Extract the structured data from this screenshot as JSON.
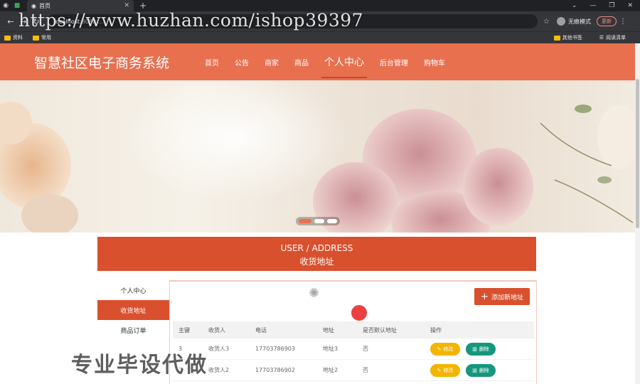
{
  "browser": {
    "tab_title": "首页",
    "url_host": "localhost",
    "url_rest": ":8080/...",
    "profile_label": "无痕模式",
    "update_label": "更新",
    "bookmarks": [
      "资料",
      "常用"
    ],
    "bookmarks_right": [
      "其他书签",
      "阅读清单"
    ]
  },
  "watermark_url": "https://www.huzhan.com/ishop39397",
  "header": {
    "logo": "智慧社区电子商务系统",
    "nav": [
      "首页",
      "公告",
      "商家",
      "商品",
      "个人中心",
      "后台管理",
      "购物车"
    ],
    "active_nav": "个人中心"
  },
  "banner": {
    "slides": 3,
    "active_slide": 1
  },
  "section_title": {
    "en": "USER / ADDRESS",
    "cn": "收货地址"
  },
  "sidebar": [
    "个人中心",
    "收货地址",
    "商品订单"
  ],
  "add_button": "添加新地址",
  "table": {
    "headers": [
      "主键",
      "收货人",
      "电话",
      "地址",
      "是否默认地址",
      "操作"
    ],
    "rows": [
      {
        "id": "3",
        "name": "收货人3",
        "phone": "17703786903",
        "address": "地址3",
        "default": "否"
      },
      {
        "id": "2",
        "name": "收货人2",
        "phone": "17703786902",
        "address": "地址2",
        "default": "否"
      }
    ],
    "edit_label": "修改",
    "delete_label": "删除"
  },
  "overlay_text": "专业毕设代做",
  "colors": {
    "header": "#e8704f",
    "accent": "#d9502e",
    "edit": "#f5b400",
    "delete": "#16967e"
  }
}
